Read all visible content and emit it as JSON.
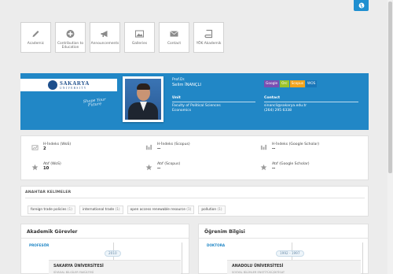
{
  "nav": {
    "tiles": [
      {
        "label": "Academic",
        "icon": "pencil-icon"
      },
      {
        "label": "Contribution to Education",
        "icon": "plus-circle-icon"
      },
      {
        "label": "Announcements",
        "icon": "megaphone-icon"
      },
      {
        "label": "Galleries",
        "icon": "image-icon"
      },
      {
        "label": "Contact",
        "icon": "envelope-icon"
      },
      {
        "label": "YÖK Akademik",
        "icon": "book-icon"
      }
    ]
  },
  "profile": {
    "university_name": "SAKARYA",
    "university_word": "UNIVERSITY",
    "slogan_line1": "Shape Your",
    "slogan_line2": "Future",
    "title": "Prof.Dr.",
    "name": "Selim İNANÇLI",
    "badges": [
      "Google",
      "Orc",
      "Scopus",
      "WOS"
    ],
    "unit_label": "Unit",
    "unit_line1": "Faculty of Political Sciences",
    "unit_line2": "Economics",
    "contact_label": "Contact",
    "contact_email": "sinancli@sakarya.edu.tr",
    "contact_phone": "(264) 295 6338"
  },
  "metrics": [
    {
      "label": "H-İndeks (WoS)",
      "value": "2",
      "icon": "chart-icon"
    },
    {
      "label": "H-İndeks (Scopus)",
      "value": "--",
      "icon": "chart-icon"
    },
    {
      "label": "H-İndeks (Google Scholar)",
      "value": "--",
      "icon": "chart-icon"
    },
    {
      "label": "Atıf (WoS)",
      "value": "10",
      "icon": "star-icon"
    },
    {
      "label": "Atıf (Scopus)",
      "value": "--",
      "icon": "star-icon"
    },
    {
      "label": "Atıf (Google Scholar)",
      "value": "--",
      "icon": "star-icon"
    }
  ],
  "keywords": {
    "title": "ANAHTAR KELİMELER",
    "tags": [
      {
        "text": "foreign trade policies",
        "count": "(1)"
      },
      {
        "text": "international trade",
        "count": "(1)"
      },
      {
        "text": "open access renewable resource",
        "count": "(1)"
      },
      {
        "text": "pollution",
        "count": "(1)"
      }
    ]
  },
  "positions": {
    "title": "Akademik Görevler",
    "subtitle": "PROFESÖR",
    "year": "2010",
    "entry_title": "SAKARYA ÜNİVERSİTESİ",
    "entry_sub": "SİYASAL BİLGİLER FAKÜLTESİ"
  },
  "education": {
    "title": "Öğrenim Bilgisi",
    "subtitle": "DOKTORA",
    "year": "1992 - 1997",
    "entry_title": "ANADOLU ÜNİVERSİTESİ",
    "entry_sub": "SOSYAL BİLİMLER ENSTİTÜSÜ/İKTİSAT"
  },
  "colors": {
    "accent": "#2187c6",
    "google": "#7b4fb2",
    "orcid": "#9cc32b",
    "scopus": "#f2a31b",
    "wos": "#1a76b8"
  }
}
